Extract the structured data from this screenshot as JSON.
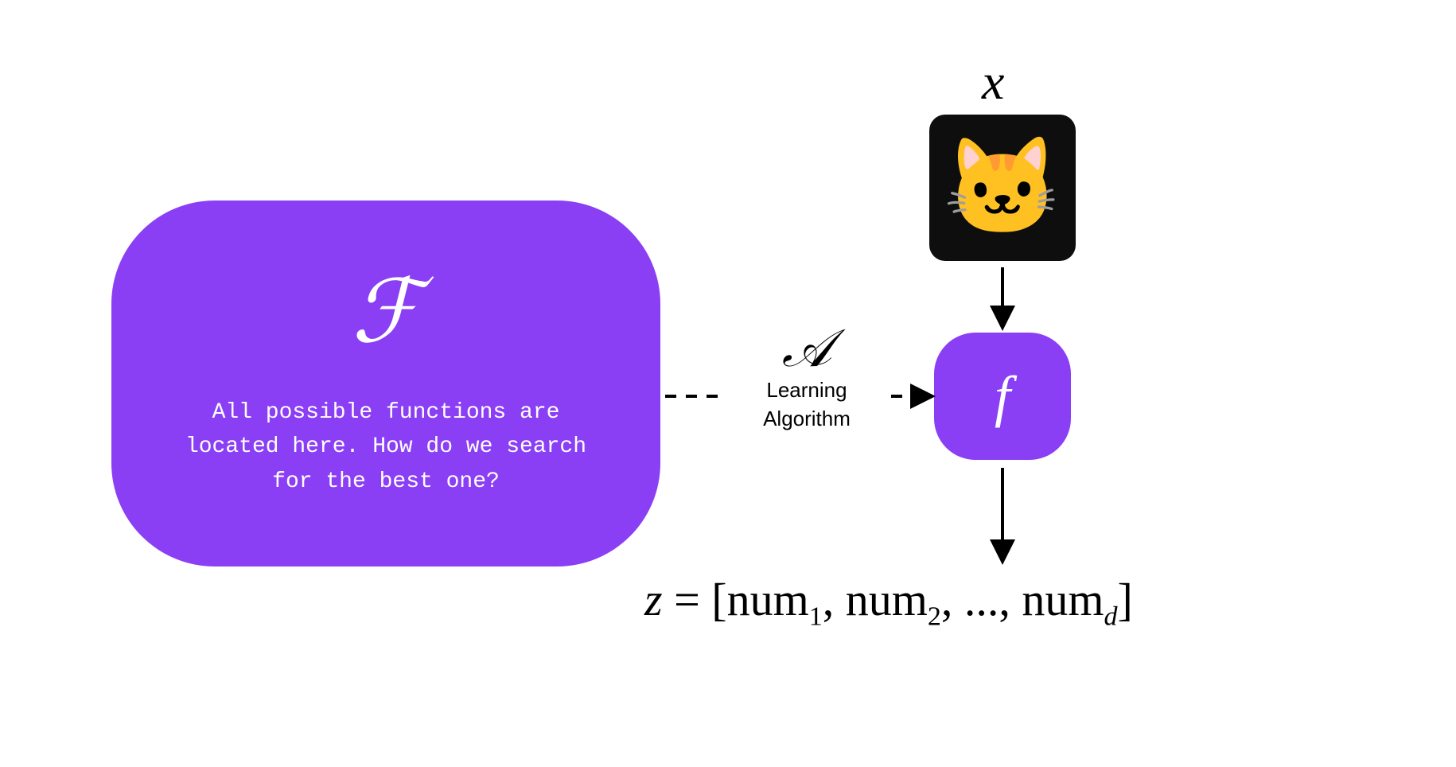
{
  "hypothesis_space": {
    "symbol": "ℱ",
    "description": "All possible functions are located here. How do we search for the best one?"
  },
  "learning_algorithm": {
    "symbol": "𝒜",
    "label_line1": "Learning",
    "label_line2": "Algorithm"
  },
  "learned_function": {
    "symbol": "f"
  },
  "input": {
    "symbol": "x",
    "emoji": "🐱"
  },
  "output": {
    "lhs": "z",
    "eq": " = ",
    "open": "[",
    "term_base": "num",
    "sub1": "1",
    "sub2": "2",
    "ellipsis": ", ..., ",
    "subd": "d",
    "close": "]",
    "sep": ", "
  },
  "colors": {
    "purple": "#8b3ff5",
    "tile_bg": "#0e0e0e"
  }
}
